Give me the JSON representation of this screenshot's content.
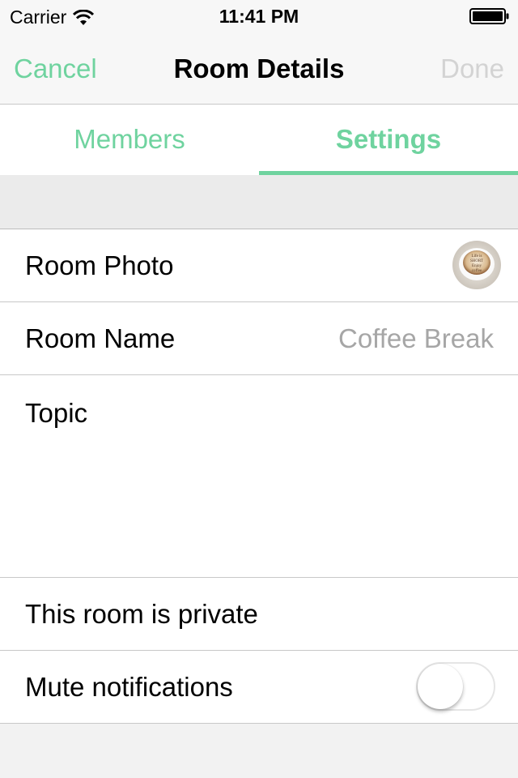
{
  "status_bar": {
    "carrier": "Carrier",
    "time": "11:41 PM",
    "icons": [
      "wifi-icon",
      "battery-icon"
    ]
  },
  "nav": {
    "cancel_label": "Cancel",
    "title": "Room Details",
    "done_label": "Done"
  },
  "tabs": [
    {
      "label": "Members",
      "active": false
    },
    {
      "label": "Settings",
      "active": true
    }
  ],
  "settings": {
    "room_photo_label": "Room Photo",
    "room_name_label": "Room Name",
    "room_name_value": "Coffee Break",
    "topic_label": "Topic",
    "private_label": "This room is private",
    "mute_label": "Mute notifications",
    "mute_enabled": false,
    "photo_text": [
      "Life is",
      "SHORT",
      "Enjoy",
      "coffee"
    ]
  },
  "colors": {
    "accent": "#6fd39f",
    "disabled": "#d3d3d3",
    "secondary_text": "#a6a6a6",
    "background": "#f2f2f2"
  }
}
